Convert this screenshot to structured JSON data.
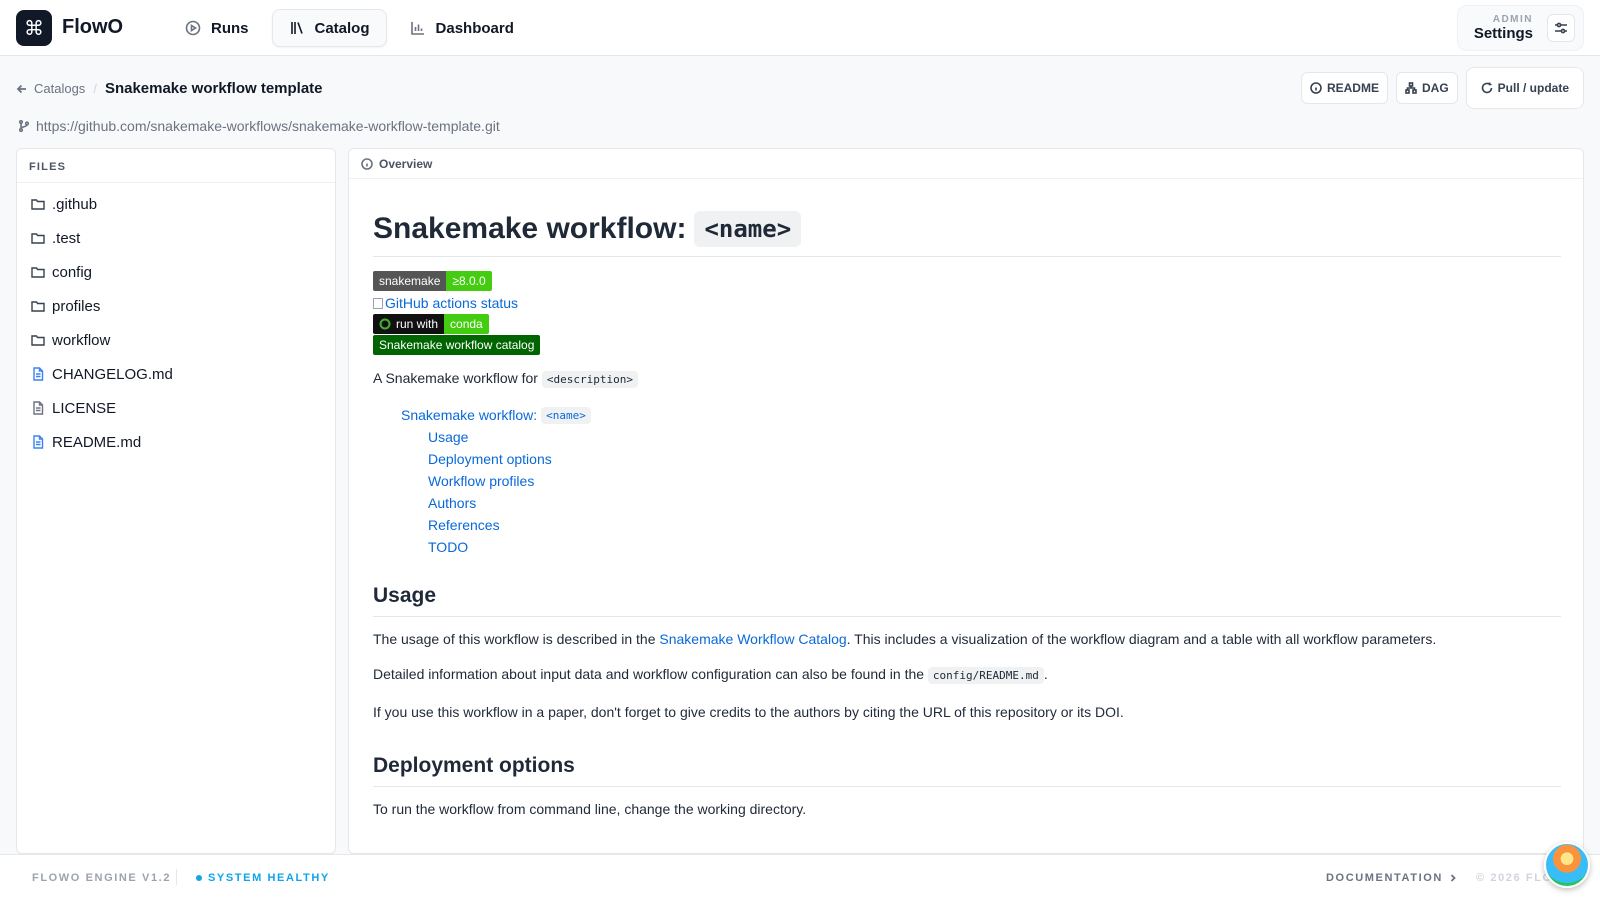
{
  "header": {
    "brand": "FlowO",
    "nav": [
      {
        "label": "Runs",
        "icon": "play-circle-icon"
      },
      {
        "label": "Catalog",
        "icon": "library-icon",
        "active": true
      },
      {
        "label": "Dashboard",
        "icon": "bar-chart-icon"
      }
    ],
    "settings_kicker": "ADMIN",
    "settings_label": "Settings"
  },
  "breadcrumb": {
    "back_label": "Catalogs",
    "current": "Snakemake workflow template"
  },
  "actions": {
    "readme": "README",
    "dag": "DAG",
    "pull": "Pull / update"
  },
  "repo_url": "https://github.com/snakemake-workflows/snakemake-workflow-template.git",
  "files": {
    "heading": "FILES",
    "items": [
      {
        "name": ".github",
        "type": "folder"
      },
      {
        "name": ".test",
        "type": "folder"
      },
      {
        "name": "config",
        "type": "folder"
      },
      {
        "name": "profiles",
        "type": "folder"
      },
      {
        "name": "workflow",
        "type": "folder"
      },
      {
        "name": "CHANGELOG.md",
        "type": "markdown"
      },
      {
        "name": "LICENSE",
        "type": "file"
      },
      {
        "name": "README.md",
        "type": "markdown"
      }
    ]
  },
  "overview": {
    "tab_label": "Overview",
    "title_text": "Snakemake workflow:",
    "title_code": "<name>",
    "badges": {
      "snakemake_left": "snakemake",
      "snakemake_right": "≥8.0.0",
      "gh_actions_alt": "GitHub actions status",
      "conda_left": "run with",
      "conda_right": "conda",
      "catalog": "Snakemake workflow catalog"
    },
    "intro_text": "A Snakemake workflow for",
    "intro_code": "<description>",
    "toc": {
      "top_text": "Snakemake workflow:",
      "top_code": "<name>",
      "items": [
        "Usage",
        "Deployment options",
        "Workflow profiles",
        "Authors",
        "References",
        "TODO"
      ]
    },
    "usage": {
      "heading": "Usage",
      "p1_before": "The usage of this workflow is described in the",
      "p1_link": "Snakemake Workflow Catalog",
      "p1_after": ". This includes a visualization of the workflow diagram and a table with all workflow parameters.",
      "p2_before": "Detailed information about input data and workflow configuration can also be found in the",
      "p2_code": "config/README.md",
      "p2_after": ".",
      "p3": "If you use this workflow in a paper, don't forget to give credits to the authors by citing the URL of this repository or its DOI."
    },
    "deployment": {
      "heading": "Deployment options",
      "p1": "To run the workflow from command line, change the working directory."
    }
  },
  "footer": {
    "version": "FLOWO ENGINE V1.2",
    "health": "SYSTEM HEALTHY",
    "docs": "DOCUMENTATION",
    "copyright": "© 2026 FLO"
  },
  "colors": {
    "accent_link": "#0969da",
    "health": "#0ea5e9",
    "badge_green": "#4c1",
    "badge_dark_green": "#006400"
  }
}
